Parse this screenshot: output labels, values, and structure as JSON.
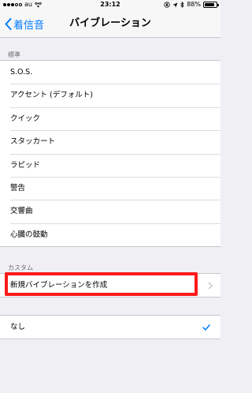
{
  "status_bar": {
    "carrier": "au",
    "time": "23:12",
    "battery_text": "88%",
    "battery_level": 0.88
  },
  "nav": {
    "back_label": "着信音",
    "title": "バイブレーション"
  },
  "sections": {
    "standard_header": "標準",
    "standard_items": [
      "S.O.S.",
      "アクセント (デフォルト)",
      "クイック",
      "スタッカート",
      "ラピッド",
      "警告",
      "交響曲",
      "心臓の鼓動"
    ],
    "custom_header": "カスタム",
    "custom_create_label": "新規バイブレーションを作成",
    "none_label": "なし"
  },
  "colors": {
    "accent": "#007aff",
    "highlight": "#ff1a1a",
    "background": "#efeff4"
  }
}
